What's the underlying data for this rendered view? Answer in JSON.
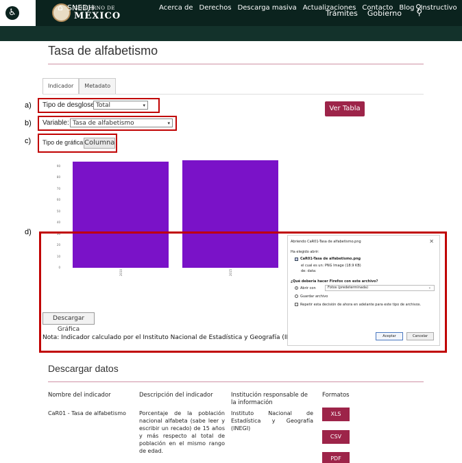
{
  "gov_header": {
    "logo_top": "GOBIERNO DE",
    "logo_bottom": "MÉXICO",
    "nav": [
      "Trámites",
      "Gobierno"
    ]
  },
  "site_nav": {
    "home_label": "SNEDH",
    "items": [
      "Acerca de",
      "Derechos",
      "Descarga masiva",
      "Actualizaciones",
      "Contacto",
      "Blog",
      "Instructivo"
    ]
  },
  "page": {
    "title": "Tasa de alfabetismo",
    "tabs": [
      "Indicador",
      "Metadato"
    ]
  },
  "controls": {
    "breakdown_label": "Tipo de desglose:",
    "breakdown_value": "Total",
    "variable_label": "Variable:",
    "variable_value": "Tasa de alfabetismo",
    "chart_type_label": "Tipo de gráfica:",
    "chart_type_value": "Columna",
    "view_table": "Ver Tabla"
  },
  "annotations": [
    "a)",
    "b)",
    "c)",
    "d)"
  ],
  "chart_data": {
    "type": "bar",
    "categories": [
      "2010",
      "2015"
    ],
    "values": [
      94,
      95
    ],
    "ylim": [
      0,
      100
    ],
    "yticks": [
      0,
      10,
      20,
      30,
      40,
      50,
      60,
      70,
      80,
      90
    ],
    "bar_color": "#7a12c8"
  },
  "chart_footer": {
    "download_chart": "Descargar Gráfica",
    "note": "Nota: Indicador calculado por el Instituto Nacional de Estadística y Geografía (INEGI)"
  },
  "dialog": {
    "title": "Abriendo CaR01-Tasa de alfabetismo.png",
    "chose": "Ha elegido abrir:",
    "file": "CaR01-Tasa de alfabetismo.png",
    "type": "el cual es un:  PNG Image (18.9 KB)",
    "from": "de:  data:",
    "question": "¿Qué debería hacer Firefox con este archivo?",
    "open_with": "Abrir con",
    "open_with_app": "Fotos (predeterminada)",
    "save": "Guardar archivo",
    "remember": "Repetir esta decisión de ahora en adelante para este tipo de archivos.",
    "accept": "Aceptar",
    "cancel": "Cancelar"
  },
  "downloads": {
    "title": "Descargar datos",
    "headers": [
      "Nombre del indicador",
      "Descripción del indicador",
      "Institución responsable de la información",
      "Formatos"
    ],
    "row": {
      "name": "CaR01 - Tasa de alfabetismo",
      "description": "Porcentaje de la población nacional alfabeta (sabe leer y escribir un recado) de 15 años y más respecto al total de población en el mismo rango de edad.",
      "institution": "Instituto Nacional de Estadística y Geografía (INEGI)"
    },
    "formats": [
      "XLS",
      "CSV",
      "PDF"
    ]
  },
  "colors": {
    "gov_dark": "#0b231e",
    "nav_dark": "#13322b",
    "accent": "#9d2449",
    "highlight": "#c00000"
  }
}
